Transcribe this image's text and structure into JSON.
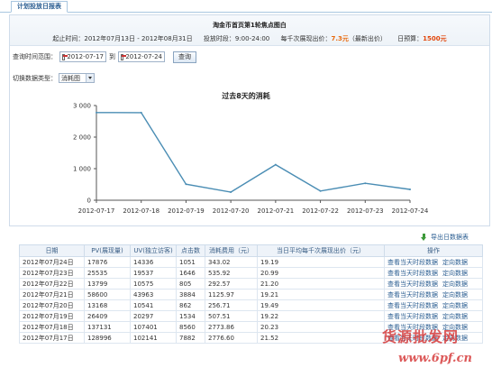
{
  "tab": {
    "label": "计划投放日报表"
  },
  "header": {
    "title": "淘金币首页第1轮焦点图白",
    "start_label": "起止时间：",
    "start_value": "2012年07月13日 - 2012年08月31日",
    "period_label": "投放时段：",
    "period_value": "9:00-24:00",
    "price_label": "每千次展现出价：",
    "price_value": "7.3元",
    "price_note": "（最新出价）",
    "budget_label": "日预算：",
    "budget_value": "1500元"
  },
  "filter": {
    "range_label": "查询时间范围：",
    "from": "2012-07-17",
    "to_label": "到",
    "to": "2012-07-24",
    "query_button": "查询"
  },
  "type_switch": {
    "label": "切换数据类型：",
    "selected": "消耗图"
  },
  "chart_data": {
    "type": "line",
    "title": "过去8天的消耗",
    "categories": [
      "2012-07-17",
      "2012-07-18",
      "2012-07-19",
      "2012-07-20",
      "2012-07-21",
      "2012-07-22",
      "2012-07-23",
      "2012-07-24"
    ],
    "values": [
      2776.6,
      2773.86,
      507.51,
      256.71,
      1125.97,
      292.57,
      535.92,
      343.02
    ],
    "ylim": [
      0,
      3000
    ],
    "yticks": [
      "0",
      "1 000",
      "2 000",
      "3 000"
    ],
    "grid": false,
    "line_color": "#4a8db4"
  },
  "export": {
    "label": "导出日数据表"
  },
  "table": {
    "columns": [
      "日期",
      "PV(展现量)",
      "UV(独立访客)",
      "点击数",
      "消耗费用（元）",
      "当日平均每千次展现出价（元）",
      "操作"
    ],
    "action_hourly": "查看当天时段数据",
    "action_targeting": "定向数据",
    "rows": [
      [
        "2012年07月24日",
        "17876",
        "14336",
        "1051",
        "343.02",
        "19.19"
      ],
      [
        "2012年07月23日",
        "25535",
        "19537",
        "1646",
        "535.92",
        "20.99"
      ],
      [
        "2012年07月22日",
        "13799",
        "10575",
        "805",
        "292.57",
        "21.20"
      ],
      [
        "2012年07月21日",
        "58600",
        "43963",
        "3884",
        "1125.97",
        "19.21"
      ],
      [
        "2012年07月20日",
        "13168",
        "10541",
        "862",
        "256.71",
        "19.49"
      ],
      [
        "2012年07月19日",
        "26409",
        "20297",
        "1534",
        "507.51",
        "19.22"
      ],
      [
        "2012年07月18日",
        "137131",
        "107401",
        "8560",
        "2773.86",
        "20.23"
      ],
      [
        "2012年07月17日",
        "128996",
        "102141",
        "7882",
        "2776.60",
        "21.52"
      ]
    ]
  },
  "watermark": {
    "line1": "货源批发网",
    "line2": "www.6pf.cn"
  }
}
